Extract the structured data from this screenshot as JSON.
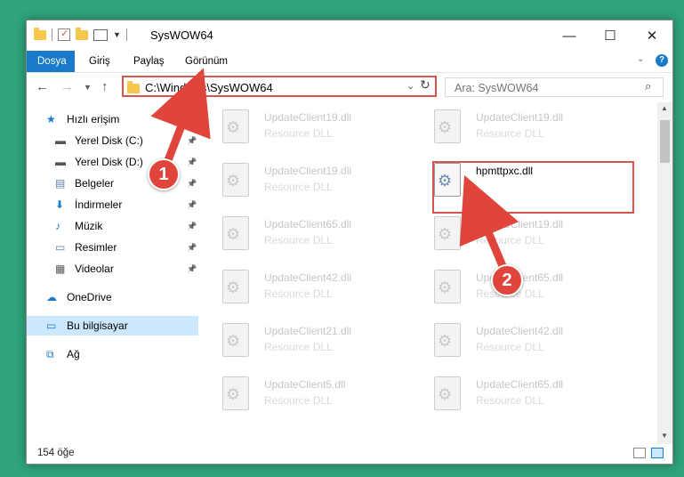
{
  "window": {
    "title": "SysWOW64",
    "controls": [
      "—",
      "☐",
      "✕"
    ]
  },
  "ribbon": {
    "tabs": [
      "Dosya",
      "Giriş",
      "Paylaş",
      "Görünüm"
    ]
  },
  "addressbar": {
    "path": "C:\\Windows\\SysWOW64",
    "search_placeholder": "Ara: SysWOW64"
  },
  "nav": {
    "items": [
      {
        "label": "Hızlı erişim",
        "icon": "star-icon",
        "pinned": false
      },
      {
        "label": "Yerel Disk (C:)",
        "icon": "drive-icon",
        "pinned": true
      },
      {
        "label": "Yerel Disk (D:)",
        "icon": "drive-icon",
        "pinned": true
      },
      {
        "label": "Belgeler",
        "icon": "documents-icon",
        "pinned": true
      },
      {
        "label": "İndirmeler",
        "icon": "download-icon",
        "pinned": true
      },
      {
        "label": "Müzik",
        "icon": "music-icon",
        "pinned": true
      },
      {
        "label": "Resimler",
        "icon": "pictures-icon",
        "pinned": true
      },
      {
        "label": "Videolar",
        "icon": "video-icon",
        "pinned": true
      },
      {
        "label": "OneDrive",
        "icon": "cloud-icon",
        "pinned": false
      },
      {
        "label": "Bu bilgisayar",
        "icon": "computer-icon",
        "pinned": false,
        "selected": true
      },
      {
        "label": "Ağ",
        "icon": "network-icon",
        "pinned": false
      }
    ]
  },
  "files": [
    {
      "name": "UpdateClient19.dll",
      "type": "Resource DLL"
    },
    {
      "name": "UpdateClient19.dll",
      "type": "Resource DLL"
    },
    {
      "name": "UpdateClient19.dll",
      "type": "Resource DLL"
    },
    {
      "name": "hpmttpxc.dll",
      "type": "",
      "highlighted": true
    },
    {
      "name": "UpdateClient65.dll",
      "type": "Resource DLL"
    },
    {
      "name": "UpdateClient19.dll",
      "type": "Resource DLL"
    },
    {
      "name": "UpdateClient42.dll",
      "type": "Resource DLL"
    },
    {
      "name": "UpdateClient65.dll",
      "type": "Resource DLL"
    },
    {
      "name": "UpdateClient21.dll",
      "type": "Resource DLL"
    },
    {
      "name": "UpdateClient42.dll",
      "type": "Resource DLL"
    },
    {
      "name": "UpdateClient5.dll",
      "type": "Resource DLL"
    },
    {
      "name": "UpdateClient65.dll",
      "type": "Resource DLL"
    }
  ],
  "status": {
    "item_count": "154 öğe"
  },
  "annotations": {
    "step1": "1",
    "step2": "2"
  },
  "colors": {
    "accent": "#1979ca",
    "highlight_border": "#d9534f",
    "badge": "#e0453c",
    "background": "#2fa37a"
  }
}
